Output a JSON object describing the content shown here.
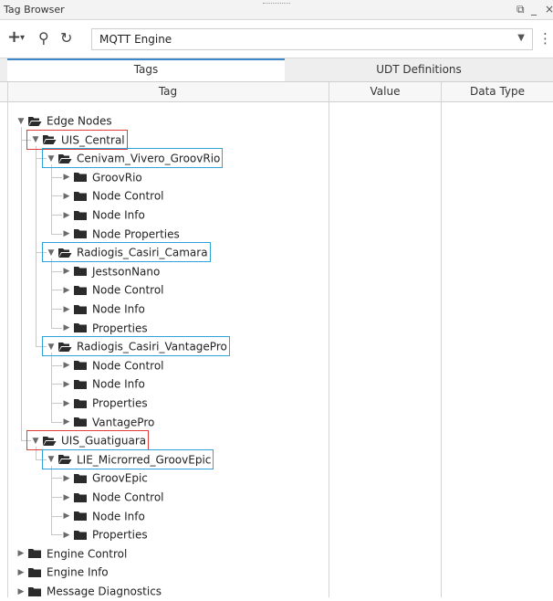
{
  "window": {
    "title": "Tag Browser",
    "restore_glyph": "⧉",
    "minimize_glyph": "_",
    "close_glyph": "×"
  },
  "toolbar": {
    "add_icon": "+",
    "add_caret": "▾",
    "search_icon": "⚲",
    "refresh_icon": "↻",
    "provider_value": "MQTT Engine",
    "provider_caret": "▼",
    "menu_icon": "⋮"
  },
  "tabs": [
    {
      "label": "Tags",
      "active": true
    },
    {
      "label": "UDT Definitions",
      "active": false
    }
  ],
  "columns": [
    "Tag",
    "Value",
    "Data Type"
  ],
  "tree": [
    {
      "label": "Edge Nodes",
      "depth": 0,
      "expanded": true,
      "box": null
    },
    {
      "label": "UIS_Central",
      "depth": 1,
      "expanded": true,
      "box": "red"
    },
    {
      "label": "Cenivam_Vivero_GroovRio",
      "depth": 2,
      "expanded": true,
      "box": "blue"
    },
    {
      "label": "GroovRio",
      "depth": 3,
      "expanded": false,
      "box": null
    },
    {
      "label": "Node Control",
      "depth": 3,
      "expanded": false,
      "box": null
    },
    {
      "label": "Node Info",
      "depth": 3,
      "expanded": false,
      "box": null
    },
    {
      "label": "Node Properties",
      "depth": 3,
      "expanded": false,
      "box": null
    },
    {
      "label": "Radiogis_Casiri_Camara",
      "depth": 2,
      "expanded": true,
      "box": "blue"
    },
    {
      "label": "JestsonNano",
      "depth": 3,
      "expanded": false,
      "box": null
    },
    {
      "label": "Node Control",
      "depth": 3,
      "expanded": false,
      "box": null
    },
    {
      "label": "Node Info",
      "depth": 3,
      "expanded": false,
      "box": null
    },
    {
      "label": "Properties",
      "depth": 3,
      "expanded": false,
      "box": null
    },
    {
      "label": "Radiogis_Casiri_VantagePro",
      "depth": 2,
      "expanded": true,
      "box": "blue"
    },
    {
      "label": "Node Control",
      "depth": 3,
      "expanded": false,
      "box": null
    },
    {
      "label": "Node Info",
      "depth": 3,
      "expanded": false,
      "box": null
    },
    {
      "label": "Properties",
      "depth": 3,
      "expanded": false,
      "box": null
    },
    {
      "label": "VantagePro",
      "depth": 3,
      "expanded": false,
      "box": null
    },
    {
      "label": "UIS_Guatiguara",
      "depth": 1,
      "expanded": true,
      "box": "red"
    },
    {
      "label": "LIE_Microrred_GroovEpic",
      "depth": 2,
      "expanded": true,
      "box": "blue"
    },
    {
      "label": "GroovEpic",
      "depth": 3,
      "expanded": false,
      "box": null
    },
    {
      "label": "Node Control",
      "depth": 3,
      "expanded": false,
      "box": null
    },
    {
      "label": "Node Info",
      "depth": 3,
      "expanded": false,
      "box": null
    },
    {
      "label": "Properties",
      "depth": 3,
      "expanded": false,
      "box": null
    },
    {
      "label": "Engine Control",
      "depth": 0,
      "expanded": false,
      "box": null
    },
    {
      "label": "Engine Info",
      "depth": 0,
      "expanded": false,
      "box": null
    },
    {
      "label": "Message Diagnostics",
      "depth": 0,
      "expanded": false,
      "box": null
    }
  ],
  "colors": {
    "folder": "#2b2b2b",
    "red_box": "#e03c3c",
    "blue_box": "#2fa3d6",
    "tab_accent": "#3c86c9"
  }
}
